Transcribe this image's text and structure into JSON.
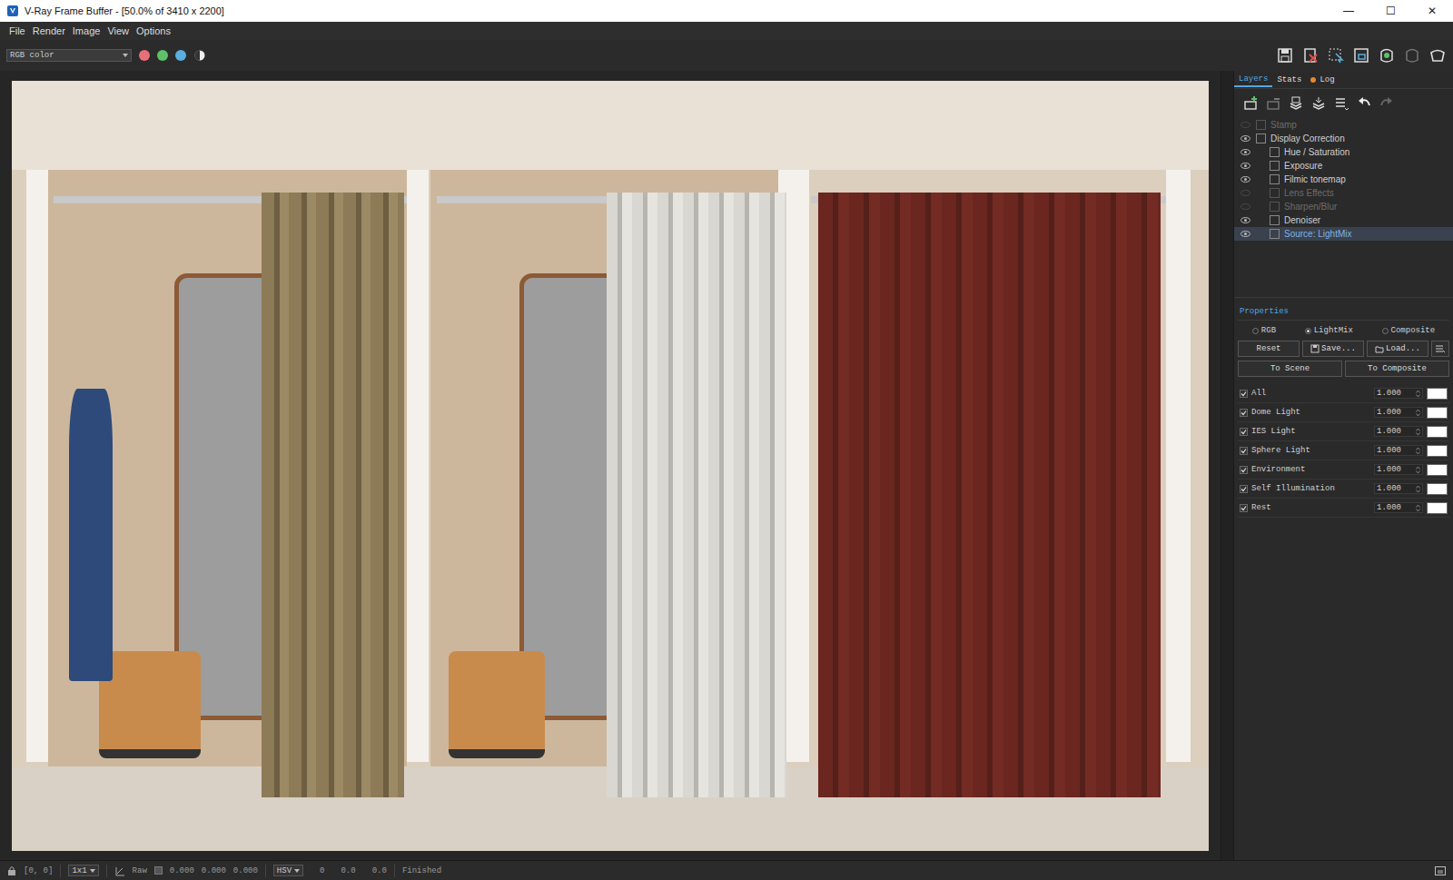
{
  "window": {
    "title": "V-Ray Frame Buffer - [50.0% of 3410 x 2200]",
    "controls": [
      "—",
      "☐",
      "✕"
    ]
  },
  "menu": [
    "File",
    "Render",
    "Image",
    "View",
    "Options"
  ],
  "toolbar": {
    "channel": "RGB color",
    "color_buttons": [
      {
        "name": "red",
        "on": true,
        "color": "#e8707a"
      },
      {
        "name": "green",
        "on": true,
        "color": "#5fc06a"
      },
      {
        "name": "blue",
        "on": true,
        "color": "#5aaee0"
      }
    ]
  },
  "panel": {
    "tabs": [
      {
        "label": "Layers",
        "selected": true,
        "alert": false
      },
      {
        "label": "Stats",
        "selected": false,
        "alert": false
      },
      {
        "label": "Log",
        "selected": false,
        "alert": true
      }
    ],
    "layers": [
      {
        "label": "Stamp",
        "visible": false,
        "enabled": false,
        "selected": false,
        "depth": 0
      },
      {
        "label": "Display Correction",
        "visible": true,
        "enabled": true,
        "selected": false,
        "depth": 0
      },
      {
        "label": "Hue / Saturation",
        "visible": true,
        "enabled": true,
        "selected": false,
        "depth": 1
      },
      {
        "label": "Exposure",
        "visible": true,
        "enabled": true,
        "selected": false,
        "depth": 1
      },
      {
        "label": "Filmic tonemap",
        "visible": true,
        "enabled": true,
        "selected": false,
        "depth": 1
      },
      {
        "label": "Lens Effects",
        "visible": false,
        "enabled": false,
        "selected": false,
        "depth": 1
      },
      {
        "label": "Sharpen/Blur",
        "visible": false,
        "enabled": false,
        "selected": false,
        "depth": 1
      },
      {
        "label": "Denoiser",
        "visible": true,
        "enabled": true,
        "selected": false,
        "depth": 1
      },
      {
        "label": "Source: LightMix",
        "visible": true,
        "enabled": true,
        "selected": true,
        "depth": 1
      }
    ]
  },
  "properties": {
    "title": "Properties",
    "modes": [
      {
        "label": "RGB",
        "selected": false
      },
      {
        "label": "LightMix",
        "selected": true
      },
      {
        "label": "Composite",
        "selected": false
      }
    ],
    "buttons": [
      "Reset",
      "Save...",
      "Load..."
    ],
    "targets": [
      "To Scene",
      "To Composite"
    ],
    "lights": [
      {
        "name": "All",
        "checked": true,
        "value": "1.000",
        "color": "#ffffff"
      },
      {
        "name": "Dome Light",
        "checked": true,
        "value": "1.000",
        "color": "#ffffff"
      },
      {
        "name": "IES Light",
        "checked": true,
        "value": "1.000",
        "color": "#ffffff"
      },
      {
        "name": "Sphere Light",
        "checked": true,
        "value": "1.000",
        "color": "#ffffff"
      },
      {
        "name": "Environment",
        "checked": true,
        "value": "1.000",
        "color": "#ffffff"
      },
      {
        "name": "Self Illumination",
        "checked": true,
        "value": "1.000",
        "color": "#ffffff"
      },
      {
        "name": "Rest",
        "checked": true,
        "value": "1.000",
        "color": "#ffffff"
      }
    ]
  },
  "status_bar": {
    "coords": "[0, 0]",
    "zoom": "1x1",
    "raw_label": "Raw",
    "raw_checked": false,
    "values": [
      "0.000",
      "0.000",
      "0.000"
    ],
    "mode": "HSV",
    "mode_values": [
      "0",
      "0.0",
      "0.0"
    ],
    "state": "Finished"
  }
}
